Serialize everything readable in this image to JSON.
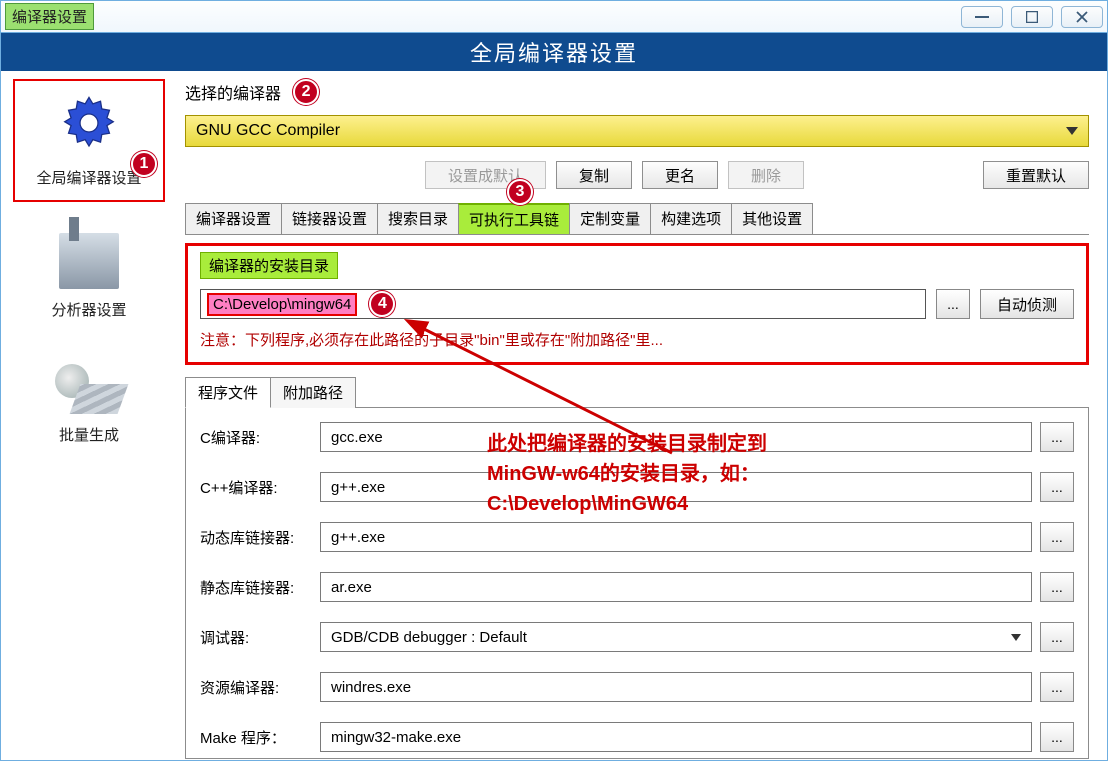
{
  "window": {
    "title": "编译器设置"
  },
  "banner": "全局编译器设置",
  "sidebar": {
    "items": [
      {
        "label": "全局编译器设置"
      },
      {
        "label": "分析器设置"
      },
      {
        "label": "批量生成"
      }
    ]
  },
  "compiler": {
    "label": "选择的编译器",
    "value": "GNU GCC Compiler",
    "buttons": {
      "set_default": "设置成默认",
      "copy": "复制",
      "rename": "更名",
      "delete": "删除",
      "reset": "重置默认"
    }
  },
  "tabs": [
    "编译器设置",
    "链接器设置",
    "搜索目录",
    "可执行工具链",
    "定制变量",
    "构建选项",
    "其他设置"
  ],
  "active_tab": "可执行工具链",
  "install": {
    "group_label": "编译器的安装目录",
    "path": "C:\\Develop\\mingw64",
    "browse": "...",
    "auto": "自动侦测",
    "note": "注意：下列程序,必须存在此路径的子目录\"bin\"里或存在\"附加路径\"里..."
  },
  "subtabs": [
    "程序文件",
    "附加路径"
  ],
  "active_subtab": "程序文件",
  "programs": {
    "c": {
      "label": "C编译器:",
      "value": "gcc.exe"
    },
    "cpp": {
      "label": "C++编译器:",
      "value": "g++.exe"
    },
    "dynlink": {
      "label": "动态库链接器:",
      "value": "g++.exe"
    },
    "statlink": {
      "label": "静态库链接器:",
      "value": "ar.exe"
    },
    "debugger": {
      "label": "调试器:",
      "value": "GDB/CDB debugger : Default"
    },
    "res": {
      "label": "资源编译器:",
      "value": "windres.exe"
    },
    "make": {
      "label": "Make 程序：",
      "value": "mingw32-make.exe"
    }
  },
  "annotations": {
    "n1": "1",
    "n2": "2",
    "n3": "3",
    "n4": "4",
    "text": "此处把编译器的安装目录制定到\nMinGW-w64的安装目录，如：\nC:\\Develop\\MinGW64"
  }
}
